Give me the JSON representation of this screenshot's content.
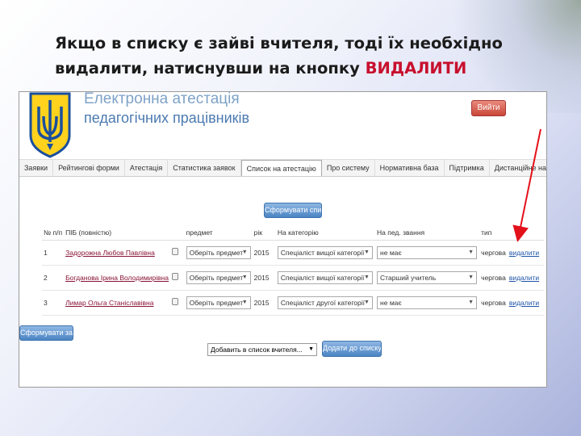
{
  "slide": {
    "title_main": "Якщо в списку є зайві вчителя, тоді їх необхідно видалити, натиснувши на кнопку ",
    "title_highlight": "ВИДАЛИТИ"
  },
  "site": {
    "title_line1": "Електронна атестація",
    "title_line2": "педагогічних працівників",
    "login_label": "Вийти"
  },
  "nav": [
    "Заявки",
    "Рейтингові форми",
    "Атестація",
    "Статистика заявок",
    "Список на атестацію",
    "Про систему",
    "Нормативна база",
    "Підтримка",
    "Дистанційне навчання"
  ],
  "buttons": {
    "form_list": "Сформувати список",
    "form_application": "Сформувати заявку",
    "add_to_list": "Додати до списку"
  },
  "table": {
    "headers": [
      "№ п/п",
      "ПІБ (повністю)",
      "",
      "предмет",
      "рік",
      "На категорію",
      "На пед. звання",
      "тип",
      ""
    ],
    "rows": [
      {
        "num": "1",
        "name": "Задорожна Любов Павлівна",
        "subject": "Оберіть предмет",
        "year": "2015",
        "category": "Спеціаліст вищої категорії",
        "title": "не має",
        "type": "чергова",
        "action": "видалити"
      },
      {
        "num": "2",
        "name": "Богданова Ірина Володимирівна",
        "subject": "Оберіть предмет",
        "year": "2015",
        "category": "Спеціаліст вищої категорії",
        "title": "Старший учитель",
        "type": "чергова",
        "action": "видалити"
      },
      {
        "num": "3",
        "name": "Лимар Ольга Станіславівна",
        "subject": "Оберіть предмет",
        "year": "2015",
        "category": "Спеціаліст другої категорії",
        "title": "не має",
        "type": "чергова",
        "action": "видалити"
      }
    ]
  },
  "add_select": {
    "value": "Добавить в список вчителя..."
  },
  "colors": {
    "accent_red": "#c8102e",
    "nav_link_blue": "#1f55a8",
    "button_blue": "#4b84c4",
    "login_red": "#c9473a"
  }
}
